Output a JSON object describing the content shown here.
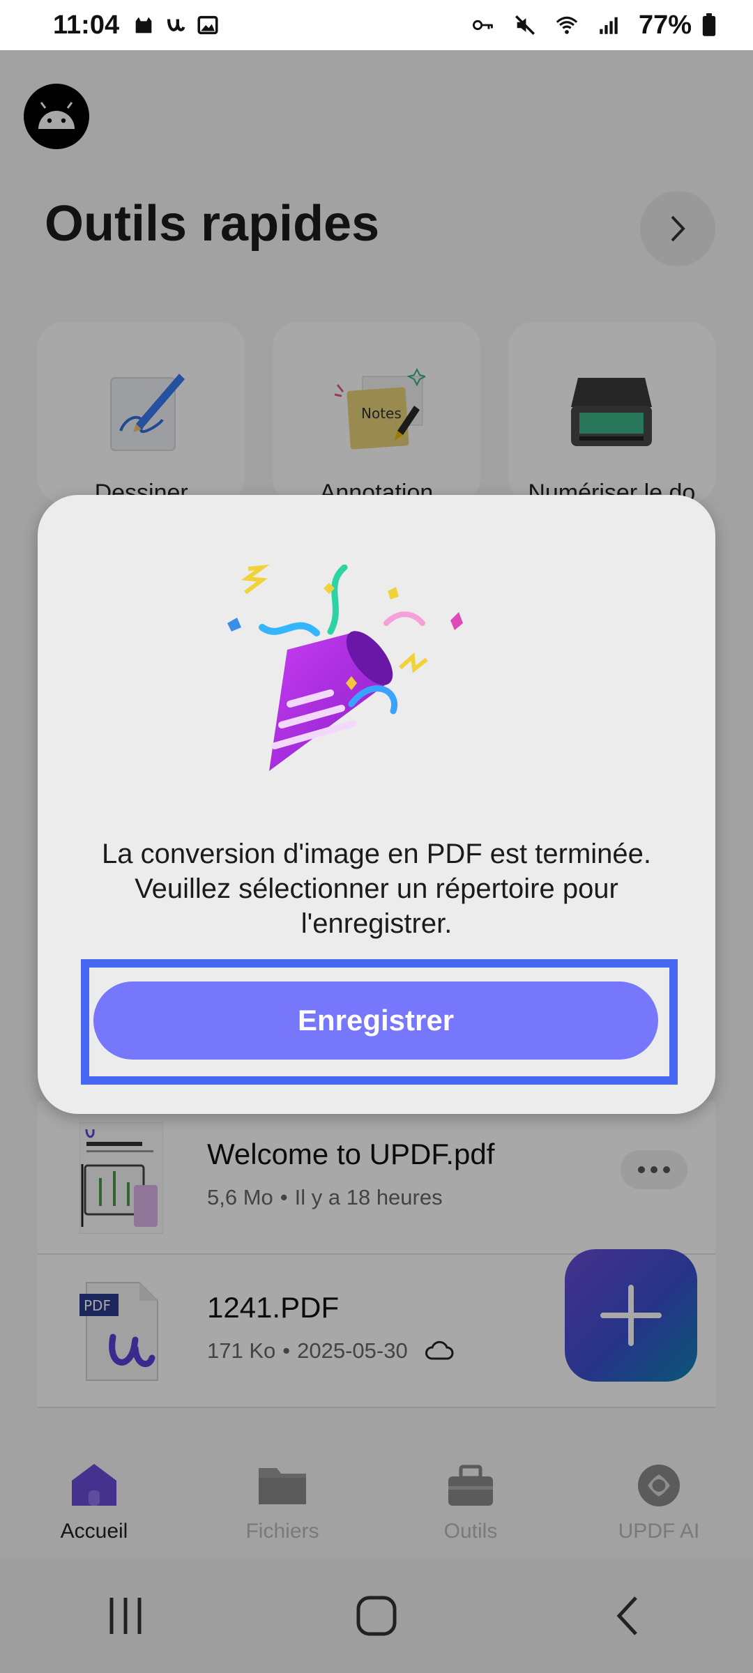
{
  "status_bar": {
    "time": "11:04",
    "battery": "77%",
    "left_icons": [
      "cat-icon",
      "updf-icon",
      "image-icon"
    ],
    "right_icons": [
      "vpn-key-icon",
      "mute-icon",
      "wifi-icon",
      "signal-icon",
      "battery-icon"
    ]
  },
  "header": {
    "avatar_icon": "android-icon",
    "section_title": "Outils rapides",
    "more_icon": "chevron-right-icon"
  },
  "quick_tools": [
    {
      "label": "Dessiner",
      "icon": "draw-pencil-icon"
    },
    {
      "label": "Annotation",
      "icon": "notes-annotation-icon"
    },
    {
      "label": "Numériser le do",
      "icon": "scanner-icon"
    }
  ],
  "dialog": {
    "illustration": "party-popper-icon",
    "message": "La conversion d'image en PDF est terminée. Veuillez sélectionner un répertoire pour l'enregistrer.",
    "button_label": "Enregistrer",
    "highlight_color": "#4567f2",
    "button_color": "#7677fa"
  },
  "files": [
    {
      "name": "Welcome to UPDF.pdf",
      "size": "5,6 Mo",
      "date": "Il y a 18 heures",
      "thumb": "pdf-preview-thumb"
    },
    {
      "name": "1241.PDF",
      "size": "171 Ko",
      "date": "2025-05-30",
      "thumb": "pdf-file-icon",
      "cloud_icon": "cloud-icon"
    }
  ],
  "meta_separator": "•",
  "fab_icon": "plus-icon",
  "bottom_nav": [
    {
      "label": "Accueil",
      "icon": "home-icon",
      "active": true
    },
    {
      "label": "Fichiers",
      "icon": "folder-icon",
      "active": false
    },
    {
      "label": "Outils",
      "icon": "toolbox-icon",
      "active": false
    },
    {
      "label": "UPDF AI",
      "icon": "ai-icon",
      "active": false
    }
  ],
  "system_nav": [
    "recents-icon",
    "home-circle-icon",
    "back-icon"
  ]
}
